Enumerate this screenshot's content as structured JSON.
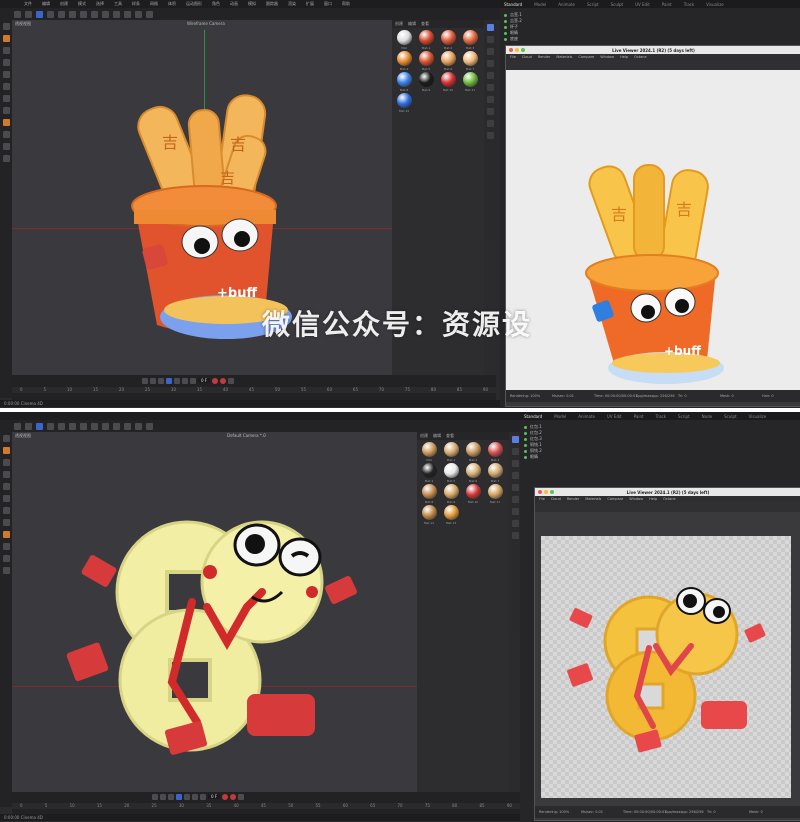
{
  "top": {
    "menu": [
      "文件",
      "编辑",
      "创建",
      "模式",
      "选择",
      "工具",
      "样条",
      "网格",
      "体积",
      "运动图形",
      "角色",
      "动画",
      "模拟",
      "跟踪器",
      "渲染",
      "扩展",
      "窗口",
      "帮助"
    ],
    "viewport_label": "透视视图",
    "viewport_center_label": "Wireframe Camera",
    "materials": [
      {
        "name": "Mat",
        "color": "#dcdcdc"
      },
      {
        "name": "Mat.1",
        "color": "#d84a2c"
      },
      {
        "name": "Mat.2",
        "color": "#e05a3a"
      },
      {
        "name": "Mat.3",
        "color": "#e26a3f"
      },
      {
        "name": "Mat.4",
        "color": "#e58b2f"
      },
      {
        "name": "Mat.5",
        "color": "#d9542f"
      },
      {
        "name": "Mat.6",
        "color": "#eaa15a"
      },
      {
        "name": "Mat.7",
        "color": "#f0b87a"
      },
      {
        "name": "Mat.8",
        "color": "#3c7fe6"
      },
      {
        "name": "Mat.9",
        "color": "#1a1a1a"
      },
      {
        "name": "Mat.10",
        "color": "#d73030"
      },
      {
        "name": "Mat.11",
        "color": "#6fba3c"
      },
      {
        "name": "Mat.12",
        "color": "#2f6de0"
      }
    ],
    "ruler": [
      "0",
      "5",
      "10",
      "15",
      "20",
      "25",
      "30",
      "35",
      "40",
      "45",
      "50",
      "55",
      "60",
      "65",
      "70",
      "75",
      "80",
      "85",
      "90"
    ],
    "frame_field": "0 F",
    "status": "0:00:00   Cinema 4D",
    "right_tabs": [
      "Standard",
      "Model",
      "Animate",
      "Script",
      "Sculpt",
      "UV Edit",
      "Paint",
      "Track",
      "Visualize"
    ],
    "objects": [
      "吉签.1",
      "吉签.2",
      "杯子",
      "眼睛",
      "底座"
    ],
    "lv_title": "Live Viewer 2024.1 (R2) (5 days left)",
    "lv_menu": [
      "File",
      "Cloud",
      "Render",
      "Materials",
      "Compare",
      "Window",
      "Help",
      "Octane"
    ],
    "lv_info": [
      "Rendering: 100%",
      "Ms/sec: 0.01",
      "Time: 00:00:00/00:00:01",
      "Spp/maxspp: 256/256",
      "Tri: 0",
      "Mesh: 0",
      "Hair: 0"
    ]
  },
  "bottom": {
    "viewport_label": "透视视图",
    "viewport_center_label": "Default Camera *.0",
    "materials": [
      {
        "name": "Mat",
        "color": "#c89a5a"
      },
      {
        "name": "Mat.1",
        "color": "#d4aa70"
      },
      {
        "name": "Mat.2",
        "color": "#c99860"
      },
      {
        "name": "Mat.3",
        "color": "#d45050"
      },
      {
        "name": "Mat.4",
        "color": "#222222"
      },
      {
        "name": "Mat.5",
        "color": "#e8e8e8"
      },
      {
        "name": "Mat.6",
        "color": "#d8b27a"
      },
      {
        "name": "Mat.7",
        "color": "#cfa870"
      },
      {
        "name": "Mat.8",
        "color": "#c58e4e"
      },
      {
        "name": "Mat.9",
        "color": "#d9a966"
      },
      {
        "name": "Mat.10",
        "color": "#d33838"
      },
      {
        "name": "Mat.11",
        "color": "#d4a460"
      },
      {
        "name": "Mat.12",
        "color": "#c08a48"
      },
      {
        "name": "Mat.13",
        "color": "#e09a3a"
      }
    ],
    "ruler": [
      "0",
      "5",
      "10",
      "15",
      "20",
      "25",
      "30",
      "35",
      "40",
      "45",
      "50",
      "55",
      "60",
      "65",
      "70",
      "75",
      "80",
      "85",
      "90"
    ],
    "frame_field": "0 F",
    "status": "0:00:00   Cinema 4D",
    "right_tabs": [
      "Standard",
      "Model",
      "Animate",
      "UV Edit",
      "Paint",
      "Track",
      "Script",
      "Node",
      "Sculpt",
      "Visualize"
    ],
    "objects": [
      "红包.1",
      "红包.2",
      "红包.3",
      "铜钱.1",
      "铜钱.2",
      "眼睛"
    ],
    "lv_title": "Live Viewer 2024.1 (R2) (5 days left)",
    "lv_menu": [
      "File",
      "Cloud",
      "Render",
      "Materials",
      "Compare",
      "Window",
      "Help",
      "Octane"
    ],
    "lv_info": [
      "Rendering: 100%",
      "Ms/sec: 0.01",
      "Time: 00:00:00/00:00:01",
      "Spp/maxspp: 256/256",
      "Tri: 0",
      "Mesh: 0"
    ]
  },
  "watermark": "微信公众号：资源设",
  "cup_text": "+buff",
  "stick_char": "吉"
}
